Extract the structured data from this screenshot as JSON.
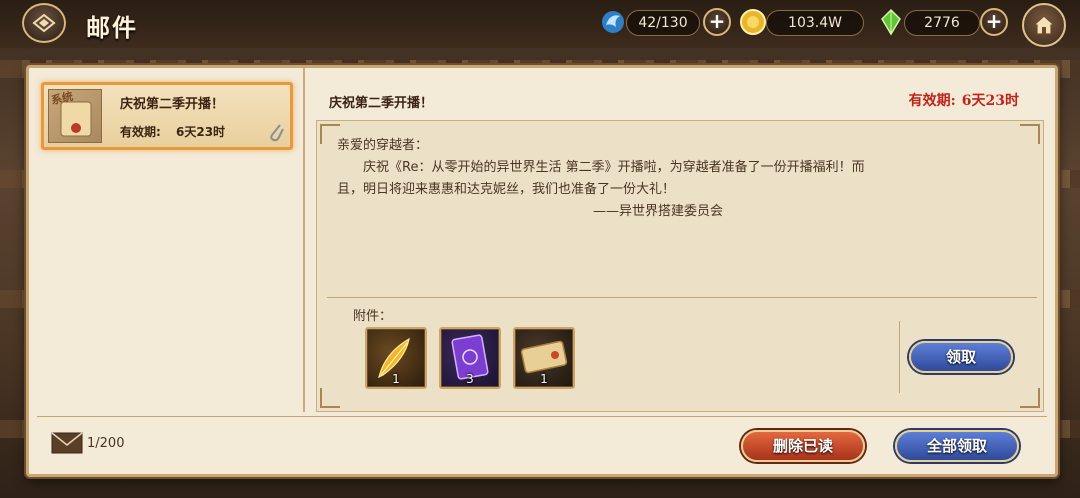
{
  "header": {
    "title": "邮件",
    "resources": [
      {
        "icon": "stamina-icon",
        "value": "42/130"
      },
      {
        "icon": "gold-coin-icon",
        "value": "103.4W"
      },
      {
        "icon": "green-crystal-icon",
        "value": "2776"
      }
    ]
  },
  "mail_list": {
    "items": [
      {
        "tag": "系统",
        "title": "庆祝第二季开播！",
        "expiry_label": "有效期:",
        "expiry_value": "6天23时"
      }
    ]
  },
  "detail": {
    "title": "庆祝第二季开播！",
    "expiry_label": "有效期:",
    "expiry_value": "6天23时",
    "greeting": "亲爱的穿越者：",
    "paragraph": "庆祝《Re：从零开始的异世界生活 第二季》开播啦，为穿越者准备了一份开播福利！而且，明日将迎来惠惠和达克妮丝，我们也准备了一份大礼！",
    "signature": "——异世界搭建委员会",
    "attachment_label": "附件：",
    "attachments": [
      {
        "icon": "golden-feather-icon",
        "count": "1"
      },
      {
        "icon": "purple-card-icon",
        "count": "3"
      },
      {
        "icon": "ticket-icon",
        "count": "1"
      }
    ],
    "claim_label": "领取"
  },
  "footer": {
    "mail_count": "1/200",
    "delete_read_label": "删除已读",
    "claim_all_label": "全部领取"
  },
  "colors": {
    "accent_red": "#c0231a",
    "selected_border": "#e89a3a",
    "panel_bg": "#f3ead8"
  }
}
